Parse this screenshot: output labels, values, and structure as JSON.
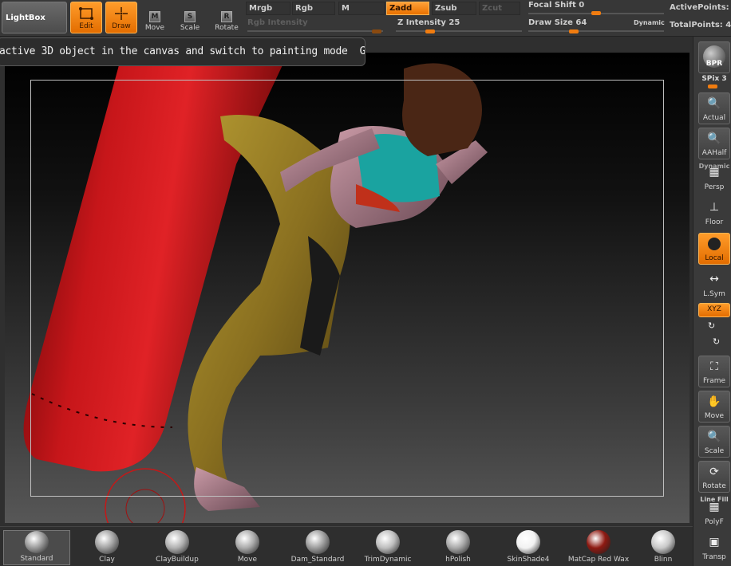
{
  "toolbar": {
    "lightbox": "LightBox",
    "edit": "Edit",
    "draw": "Draw",
    "move": "Move",
    "move_key": "M",
    "scale": "Scale",
    "scale_key": "S",
    "rotate": "Rotate",
    "rotate_key": "R",
    "mrgb": "Mrgb",
    "rgb": "Rgb",
    "m": "M",
    "zadd": "Zadd",
    "zsub": "Zsub",
    "zcut": "Zcut",
    "rgb_intensity": "Rgb Intensity",
    "z_intensity": "Z Intensity 25",
    "focal_shift": "Focal Shift 0",
    "draw_size": "Draw Size 64",
    "dynamic": "Dynamic",
    "active_points": "ActivePoints:",
    "total_points": "TotalPoints: 4"
  },
  "sliders": {
    "z_intensity": 0.25,
    "focal_shift": 0.5,
    "draw_size": 0.32
  },
  "tooltip": {
    "text": "active 3D object in the canvas and switch to painting mode",
    "hotkey": "G"
  },
  "shelf": {
    "bpr": "BPR",
    "spix": "SPix 3",
    "actual": "Actual",
    "aahalf": "AAHalf",
    "dynamic": "Dynamic",
    "persp": "Persp",
    "floor": "Floor",
    "local": "Local",
    "lsym": "L.Sym",
    "xyz": "XYZ",
    "frame": "Frame",
    "move": "Move",
    "scale": "Scale",
    "rotate": "Rotate",
    "line_fill": "Line Fill",
    "polyf": "PolyF",
    "transp": "Transp"
  },
  "brushes": [
    {
      "label": "Standard",
      "color": "#9a9a9a"
    },
    {
      "label": "Clay",
      "color": "#a0a0a0"
    },
    {
      "label": "ClayBuildup",
      "color": "#b0b0b0"
    },
    {
      "label": "Move",
      "color": "#aaaaaa"
    },
    {
      "label": "Dam_Standard",
      "color": "#9c9c9c"
    },
    {
      "label": "TrimDynamic",
      "color": "#bdbdbd"
    },
    {
      "label": "hPolish",
      "color": "#a8a8a8"
    },
    {
      "label": "SkinShade4",
      "color": "#f2f2f2"
    },
    {
      "label": "MatCap Red Wax",
      "color": "#8e1a12"
    },
    {
      "label": "Blinn",
      "color": "#c8c8c8"
    }
  ]
}
